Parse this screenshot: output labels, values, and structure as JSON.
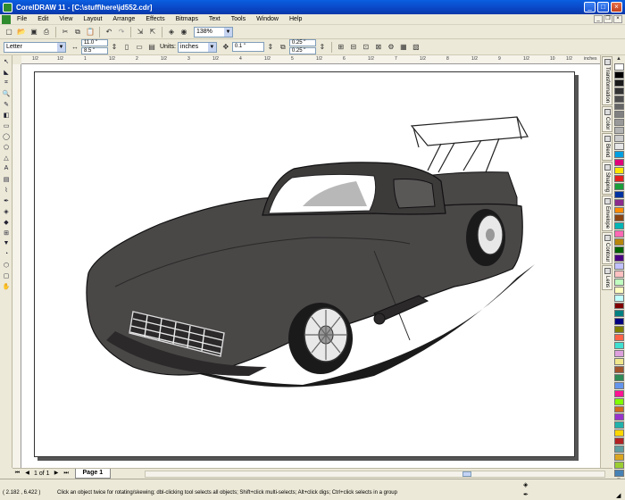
{
  "window": {
    "title": "CorelDRAW 11 - [C:\\stuff\\here\\jd552.cdr]"
  },
  "menu": [
    "File",
    "Edit",
    "View",
    "Layout",
    "Arrange",
    "Effects",
    "Bitmaps",
    "Text",
    "Tools",
    "Window",
    "Help"
  ],
  "toolbar": {
    "zoom": "138%"
  },
  "property_bar": {
    "paper": "Letter",
    "width": "11.0 \"",
    "height": "8.5 \"",
    "units_label": "Units:",
    "units": "inches",
    "nudge": "0.1 \"",
    "dup_x": "0.25 \"",
    "dup_y": "0.25 \""
  },
  "rulers": {
    "top": [
      "1/2",
      "1/2",
      "1",
      "1/2",
      "2",
      "1/2",
      "3",
      "1/2",
      "4",
      "1/2",
      "5",
      "1/2",
      "6",
      "1/2",
      "7",
      "1/2",
      "8",
      "1/2",
      "9",
      "1/2",
      "10",
      "1/2",
      "inches"
    ],
    "corner_label": "inches"
  },
  "dockers": [
    "Transformation",
    "Color",
    "Blend",
    "Shaping",
    "Envelope",
    "Contour",
    "Lens"
  ],
  "page_nav": {
    "page_count": "1 of 1",
    "page_tab": "Page 1"
  },
  "status": {
    "coords": "( 2.182 , 6.422 )",
    "hint": "Click an object twice for rotating/skewing; dbl-clicking tool selects all objects; Shift+click multi-selects; Alt+click digs; Ctrl+click selects in a group"
  },
  "colors": {
    "body": "#4a4747",
    "body_dark": "#2b2929",
    "shadow": "#1a1a1a",
    "titlebar": "#0a46c4"
  },
  "palette": [
    "#ffffff",
    "#000000",
    "#1a1a1a",
    "#333333",
    "#4d4d4d",
    "#666666",
    "#808080",
    "#999999",
    "#b3b3b3",
    "#cccccc",
    "#e6e6e6",
    "#00a0e0",
    "#e0007a",
    "#ffe600",
    "#e62020",
    "#1a9e3a",
    "#0033a0",
    "#8c2b8c",
    "#ff8c00",
    "#8b4513",
    "#00b5b5",
    "#ff69b4",
    "#b8860b",
    "#006400",
    "#4b0082",
    "#c0c0ff",
    "#ffc0c0",
    "#c0ffc0",
    "#ffffc0",
    "#c0ffff",
    "#800000",
    "#008080",
    "#000080",
    "#808000",
    "#ff6347",
    "#40e0d0",
    "#dda0dd",
    "#f0e68c",
    "#a0522d",
    "#2e8b57",
    "#6495ed",
    "#ff1493",
    "#7fff00",
    "#d2691e",
    "#9932cc",
    "#20b2aa",
    "#ffd700",
    "#b22222",
    "#5f9ea0",
    "#daa520",
    "#9acd32",
    "#4682b4"
  ]
}
